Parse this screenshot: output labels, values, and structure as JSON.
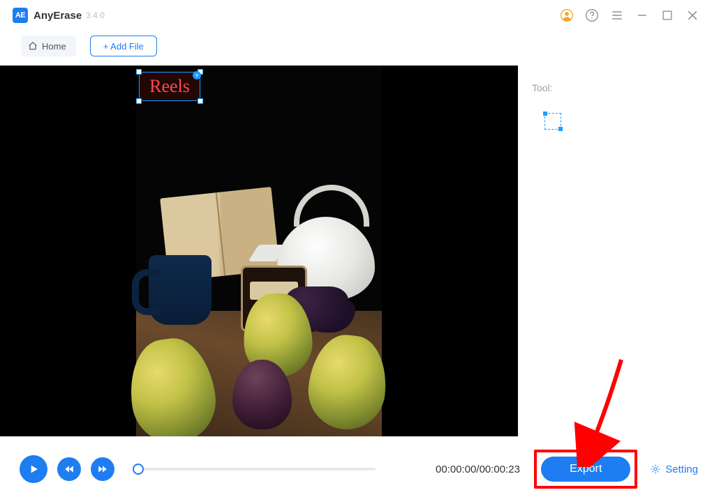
{
  "app": {
    "logo_text": "AE",
    "name": "AnyErase",
    "version": "3.4.0"
  },
  "titlebar_icons": {
    "user": "user-icon",
    "help": "help-icon",
    "menu": "menu-icon",
    "minimize": "minimize-icon",
    "maximize": "maximize-icon",
    "close": "close-icon"
  },
  "toolbar": {
    "home_label": "Home",
    "addfile_label": "+ Add File"
  },
  "selection": {
    "watermark_text": "Reels"
  },
  "tool_panel": {
    "label": "Tool:",
    "selection_tool": "selection-rectangle"
  },
  "playback": {
    "current_time": "00:00:00",
    "total_time": "00:00:23",
    "separator": "/"
  },
  "bottom": {
    "export_label": "Export",
    "setting_label": "Setting"
  }
}
